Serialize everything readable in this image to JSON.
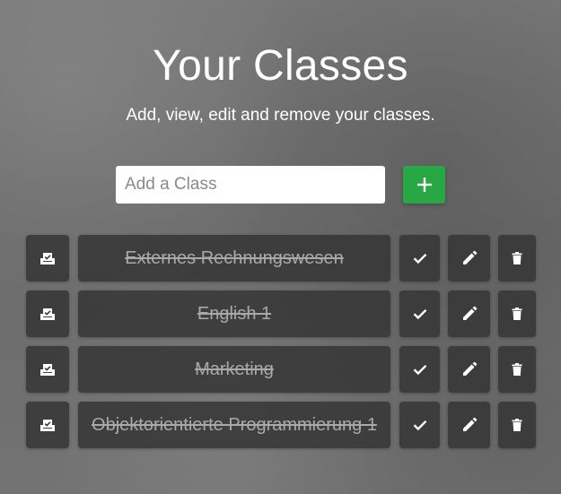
{
  "header": {
    "title": "Your Classes",
    "subtitle": "Add, view, edit and remove your classes."
  },
  "add_form": {
    "placeholder": "Add a Class",
    "button_icon": "plus-icon",
    "button_color": "#28a745"
  },
  "classes": [
    {
      "name": "Externes Rechnungswesen",
      "completed": true
    },
    {
      "name": "English 1",
      "completed": true
    },
    {
      "name": "Marketing",
      "completed": true
    },
    {
      "name": "Objektorientierte Programmierung 1",
      "completed": true
    }
  ],
  "row_icons": {
    "archive": "archive-icon",
    "check": "check-icon",
    "edit": "pencil-icon",
    "delete": "trash-icon"
  }
}
